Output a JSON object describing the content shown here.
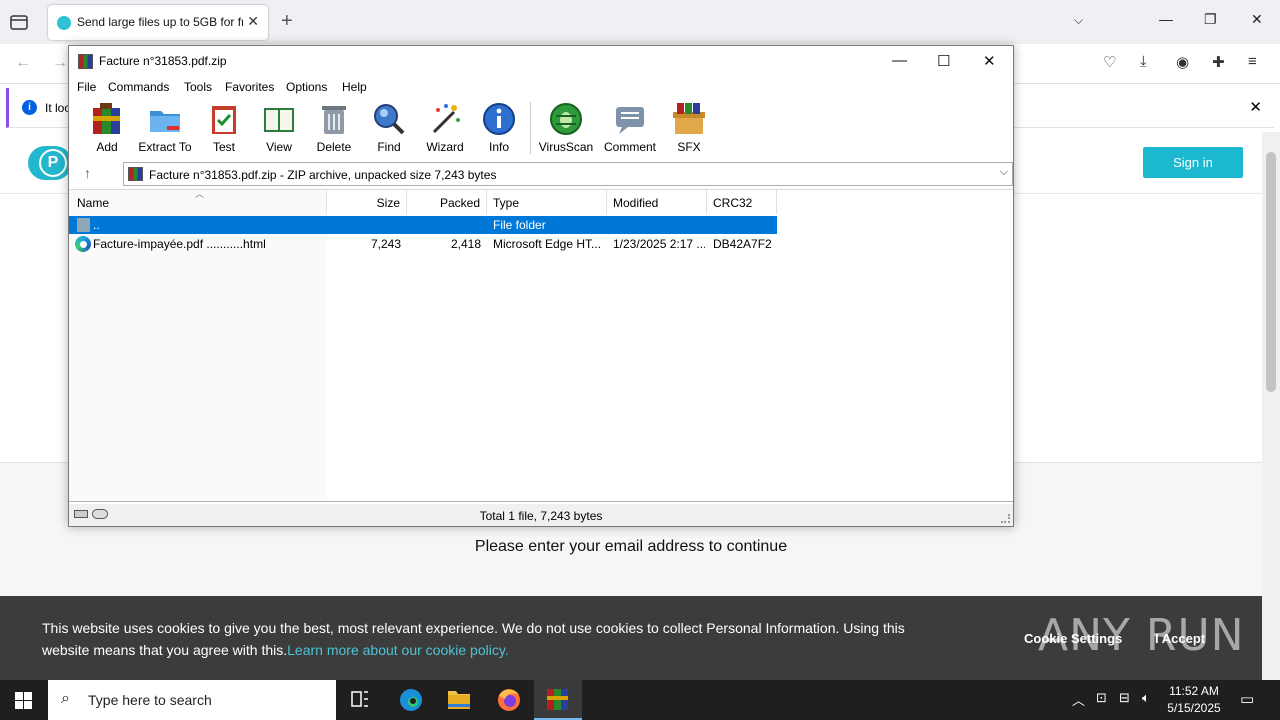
{
  "browser": {
    "tab_title": "Send large files up to 5GB for fr",
    "notification_text": "It loo",
    "page_sign_in": "Sign in",
    "page_logo_letter": "P",
    "page_message": "Please enter your email address to continue",
    "cookie": {
      "text": "This website uses cookies to give you the best, most relevant experience. We do not use cookies to collect Personal Information. Using this website means that you agree with this.",
      "link": "Learn more about our cookie policy.",
      "settings": "Cookie Settings",
      "accept": "I Accept"
    },
    "watermark": "ANY RUN"
  },
  "winrar": {
    "title": "Facture n°31853.pdf.zip",
    "menu": [
      "File",
      "Commands",
      "Tools",
      "Favorites",
      "Options",
      "Help"
    ],
    "toolbar": [
      "Add",
      "Extract To",
      "Test",
      "View",
      "Delete",
      "Find",
      "Wizard",
      "Info",
      "VirusScan",
      "Comment",
      "SFX"
    ],
    "address": "Facture n°31853.pdf.zip - ZIP archive, unpacked size 7,243 bytes",
    "columns": [
      "Name",
      "Size",
      "Packed",
      "Type",
      "Modified",
      "CRC32"
    ],
    "rows": [
      {
        "name": "..",
        "size": "",
        "packed": "",
        "type": "File folder",
        "modified": "",
        "crc": ""
      },
      {
        "name": "Facture-impayée.pdf ...........html",
        "size": "7,243",
        "packed": "2,418",
        "type": "Microsoft Edge HT...",
        "modified": "1/23/2025 2:17 ...",
        "crc": "DB42A7F2"
      }
    ],
    "status": "Total 1 file, 7,243 bytes"
  },
  "taskbar": {
    "search_placeholder": "Type here to search",
    "time": "11:52 AM",
    "date": "5/15/2025"
  },
  "colors": {
    "selection": "#0078d7",
    "accent_teal": "#1cb8cf",
    "taskbar": "#1f1f1f"
  }
}
